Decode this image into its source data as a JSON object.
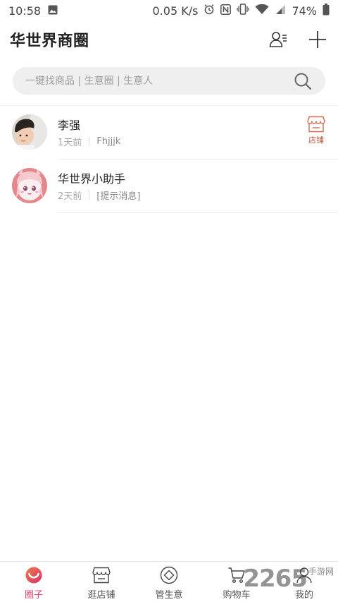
{
  "status_bar": {
    "time": "10:58",
    "speed": "0.05 K/s",
    "battery": "74%"
  },
  "header": {
    "title": "华世界商圈"
  },
  "search": {
    "placeholder": "一键找商品 | 生意圈 | 生意人"
  },
  "conversations": [
    {
      "name": "李强",
      "time": "1天前",
      "message": "Fhjjjk",
      "shop_label": "店铺"
    },
    {
      "name": "华世界小助手",
      "time": "2天前",
      "message": "[提示消息]"
    }
  ],
  "bottom_nav": [
    {
      "label": "圈子",
      "icon": "circle-icon",
      "active": true
    },
    {
      "label": "逛店铺",
      "icon": "store-icon",
      "active": false
    },
    {
      "label": "管生意",
      "icon": "business-icon",
      "active": false
    },
    {
      "label": "购物车",
      "icon": "cart-icon",
      "active": false
    },
    {
      "label": "我的",
      "icon": "profile-icon",
      "active": false
    }
  ],
  "watermark": {
    "number": "2265",
    "text": "手游网"
  },
  "colors": {
    "accent": "#e0456a",
    "shop": "#c45a42",
    "search_bg": "#efefef"
  }
}
